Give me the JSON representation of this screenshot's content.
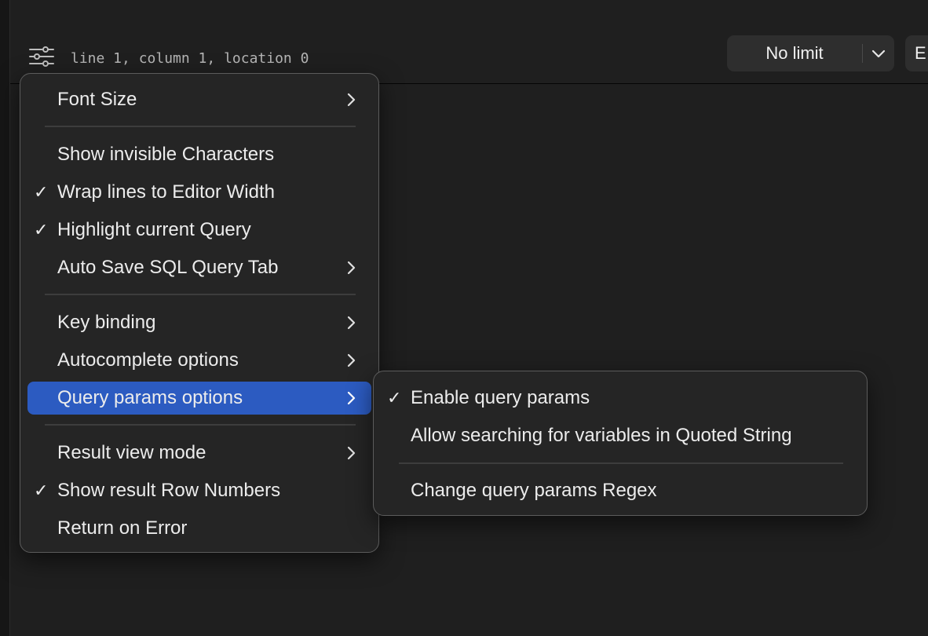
{
  "status": {
    "position_text": "line 1, column 1, location 0"
  },
  "limit_select": {
    "value": "No limit"
  },
  "next_button": {
    "label": "E"
  },
  "menu": {
    "items": [
      {
        "label": "Font Size",
        "checked": false,
        "submenu": true
      },
      {
        "label": "Show invisible Characters",
        "checked": false,
        "submenu": false
      },
      {
        "label": "Wrap lines to Editor Width",
        "checked": true,
        "submenu": false
      },
      {
        "label": "Highlight current Query",
        "checked": true,
        "submenu": false
      },
      {
        "label": "Auto Save SQL Query Tab",
        "checked": false,
        "submenu": true
      },
      {
        "label": "Key binding",
        "checked": false,
        "submenu": true
      },
      {
        "label": "Autocomplete options",
        "checked": false,
        "submenu": true
      },
      {
        "label": "Query params options",
        "checked": false,
        "submenu": true,
        "active": true
      },
      {
        "label": "Result view mode",
        "checked": false,
        "submenu": true
      },
      {
        "label": "Show result Row Numbers",
        "checked": true,
        "submenu": false
      },
      {
        "label": "Return on Error",
        "checked": false,
        "submenu": false
      }
    ]
  },
  "submenu": {
    "items": [
      {
        "label": "Enable query params",
        "checked": true
      },
      {
        "label": "Allow searching for variables in Quoted String",
        "checked": false
      },
      {
        "label": "Change query params Regex",
        "checked": false
      }
    ]
  },
  "check_glyph": "✓",
  "colors": {
    "background": "#1f1f1f",
    "menu_bg": "#252525",
    "highlight": "#2c5bc1",
    "text": "#ececec"
  }
}
